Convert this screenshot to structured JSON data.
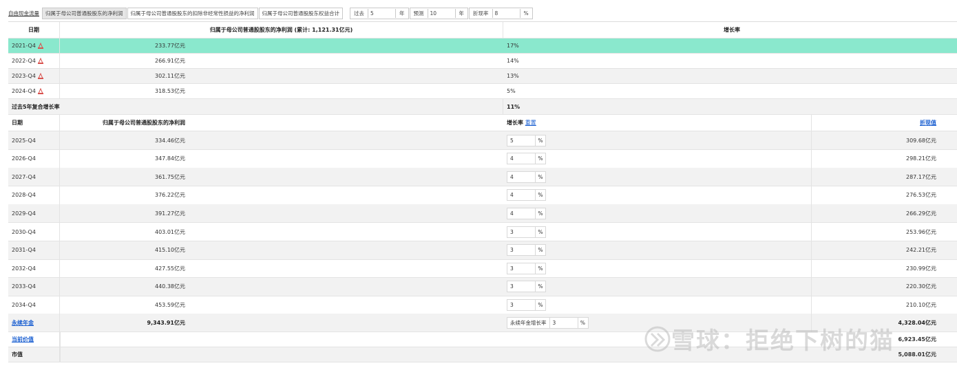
{
  "toolbar": {
    "tabs": [
      "自由现金流量",
      "归属于母公司普通股股东的净利润",
      "归属于母公司普通股股东的扣除非经常性损益的净利润",
      "归属于母公司普通股股东权益合计"
    ],
    "params": [
      {
        "label": "过去",
        "value": "5",
        "unit": "年"
      },
      {
        "label": "预测",
        "value": "10",
        "unit": "年"
      },
      {
        "label": "折现率",
        "value": "8",
        "unit": "%"
      }
    ]
  },
  "table": {
    "header": {
      "date": "日期",
      "profit": "归属于母公司普通股股东的净利润 (累计: 1,121.31亿元)",
      "growth": "增长率"
    },
    "history": [
      {
        "date": "2021-Q4",
        "value": "233.77亿元",
        "growth": "17%"
      },
      {
        "date": "2022-Q4",
        "value": "266.91亿元",
        "growth": "14%"
      },
      {
        "date": "2023-Q4",
        "value": "302.11亿元",
        "growth": "13%"
      },
      {
        "date": "2024-Q4",
        "value": "318.53亿元",
        "growth": "5%"
      }
    ],
    "cagr": {
      "label": "过去5年复合增长率",
      "value": "11%"
    },
    "forecast_header": {
      "date": "日期",
      "profit": "归属于母公司普通股股东的净利润",
      "growth": "增长率",
      "reset": "重置",
      "pv": "折现值"
    },
    "forecast": [
      {
        "date": "2025-Q4",
        "value": "334.46亿元",
        "growth": "5",
        "pv": "309.68亿元"
      },
      {
        "date": "2026-Q4",
        "value": "347.84亿元",
        "growth": "4",
        "pv": "298.21亿元"
      },
      {
        "date": "2027-Q4",
        "value": "361.75亿元",
        "growth": "4",
        "pv": "287.17亿元"
      },
      {
        "date": "2028-Q4",
        "value": "376.22亿元",
        "growth": "4",
        "pv": "276.53亿元"
      },
      {
        "date": "2029-Q4",
        "value": "391.27亿元",
        "growth": "4",
        "pv": "266.29亿元"
      },
      {
        "date": "2030-Q4",
        "value": "403.01亿元",
        "growth": "3",
        "pv": "253.96亿元"
      },
      {
        "date": "2031-Q4",
        "value": "415.10亿元",
        "growth": "3",
        "pv": "242.21亿元"
      },
      {
        "date": "2032-Q4",
        "value": "427.55亿元",
        "growth": "3",
        "pv": "230.99亿元"
      },
      {
        "date": "2033-Q4",
        "value": "440.38亿元",
        "growth": "3",
        "pv": "220.30亿元"
      },
      {
        "date": "2034-Q4",
        "value": "453.59亿元",
        "growth": "3",
        "pv": "210.10亿元"
      }
    ],
    "perpetuity": {
      "label": "永续年金",
      "value": "9,343.91亿元",
      "growth_label": "永续年金增长率",
      "growth": "3",
      "pv": "4,328.04亿元"
    },
    "current_value": {
      "label": "当前价值",
      "value": "6,923.45亿元"
    },
    "market_cap": {
      "label": "市值",
      "value": "5,088.01亿元"
    },
    "percent_unit": "%"
  },
  "watermark": "雪球：拒绝下树的猫",
  "colors": {
    "highlight": "#8ae8cd",
    "link": "#1a5fd1",
    "row_alt": "#f2f2f2"
  }
}
